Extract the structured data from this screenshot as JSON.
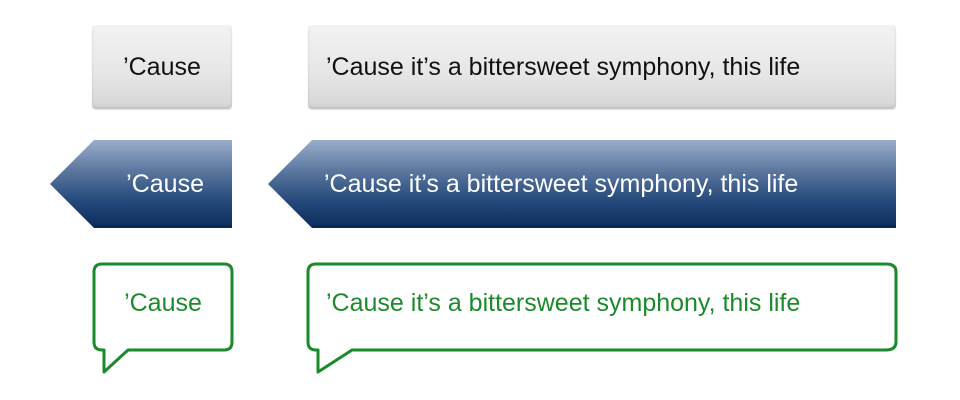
{
  "buttons": {
    "grey": {
      "short_label": "’Cause",
      "long_label": "’Cause it’s a bittersweet symphony, this life"
    },
    "blue": {
      "short_label": "’Cause",
      "long_label": "’Cause it’s a bittersweet symphony, this life"
    },
    "bubble": {
      "short_label": "’Cause",
      "long_label": "’Cause it’s a bittersweet symphony, this life"
    }
  },
  "colors": {
    "grey_text": "#111111",
    "blue_gradient_top": "#9aaecb",
    "blue_gradient_bottom": "#0b2c5c",
    "bubble_green": "#1b8a2c"
  }
}
